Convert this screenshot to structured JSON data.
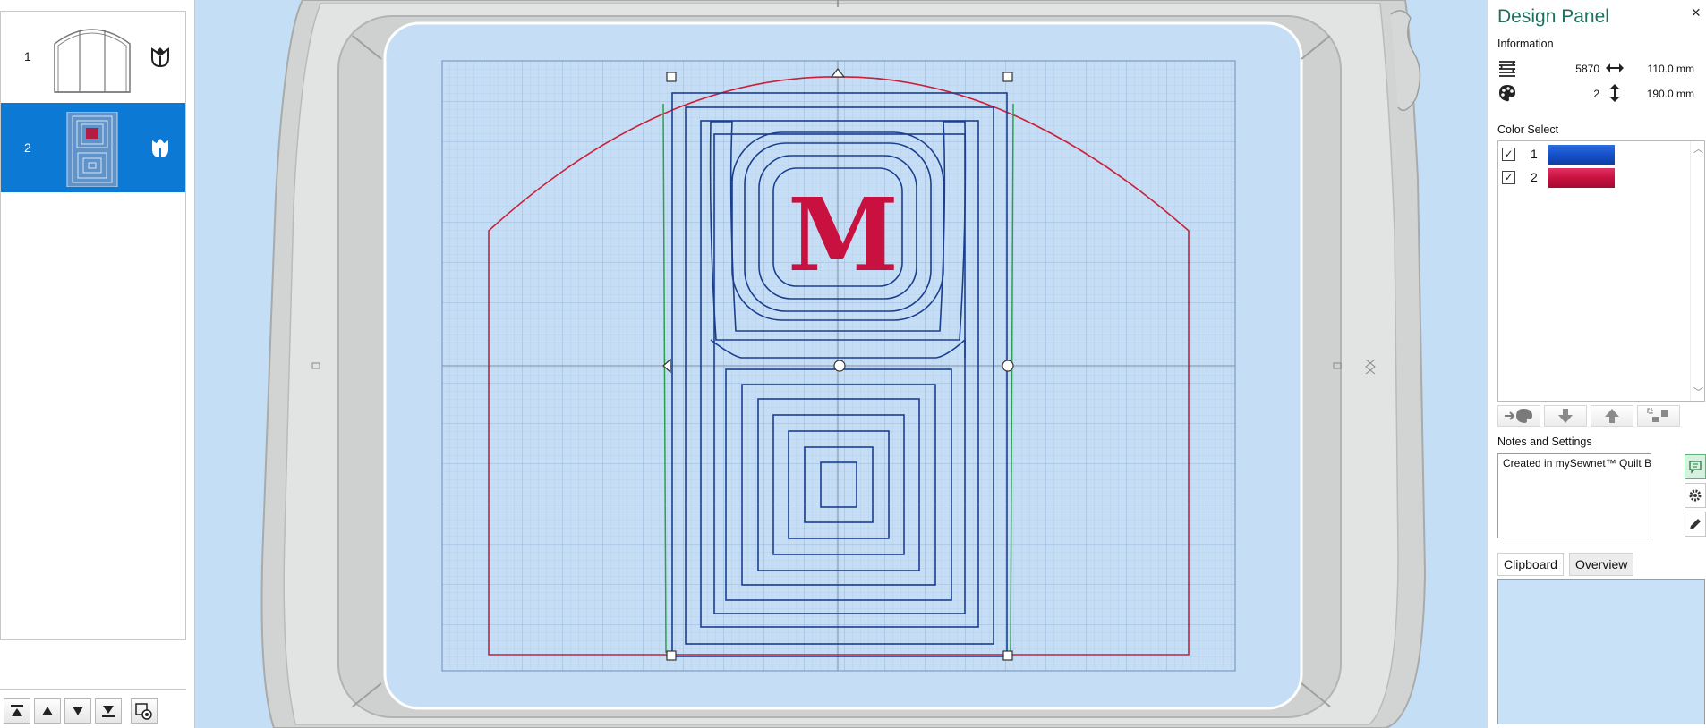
{
  "left_panel": {
    "designs": [
      {
        "number": "1",
        "selected": false,
        "thumb": "arch-window-thumbnail",
        "icon": "tulip-outline-icon"
      },
      {
        "number": "2",
        "selected": true,
        "thumb": "quilt-block-thumbnail",
        "icon": "tulip-filled-icon"
      }
    ],
    "toolbar": [
      "move-to-top-icon",
      "move-up-icon",
      "move-down-icon",
      "move-to-bottom-icon",
      "view-design-icon"
    ]
  },
  "design_panel": {
    "title": "Design Panel",
    "close_label": "×",
    "information_label": "Information",
    "stitch_count": "5870",
    "width": "110.0 mm",
    "color_count": "2",
    "height": "190.0 mm",
    "color_select_label": "Color Select",
    "colors": [
      {
        "number": "1",
        "checked": true,
        "hex": "#1550c8"
      },
      {
        "number": "2",
        "checked": true,
        "hex": "#c8113f"
      }
    ],
    "color_buttons": [
      "apply-color-icon",
      "move-color-down-icon",
      "move-color-up-icon",
      "group-colors-icon"
    ],
    "notes_label": "Notes and Settings",
    "notes_text": "Created in mySewnet™ Quilt Block",
    "side_buttons": [
      "notes-icon",
      "settings-icon",
      "edit-icon"
    ],
    "tabs": [
      {
        "label": "Clipboard",
        "active": true
      },
      {
        "label": "Overview",
        "active": false
      }
    ]
  },
  "canvas": {
    "background": "#c4def6",
    "hoop_color": "#d2d4d4",
    "grid_color": "#a9c4e0",
    "outline_color": "#cc1f3a",
    "stitch_color": "#1b3f8f",
    "guide_color": "#2aa04a",
    "monogram_letter": "M",
    "monogram_color": "#c8113f"
  }
}
